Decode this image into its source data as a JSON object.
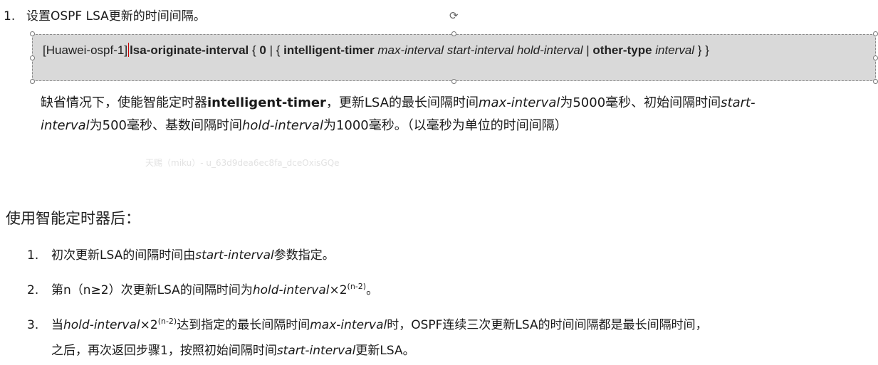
{
  "step1": {
    "number": "1.",
    "text": "设置OSPF LSA更新的时间间隔。"
  },
  "command": {
    "prompt": "[Huawei-ospf-1]",
    "cmd_a": "lsa",
    "cmd_b": "-originate-interval",
    "brace_open": " { ",
    "zero": "0",
    "sep1": " | { ",
    "intelligent": "intelligent-timer",
    "params": " max-interval start-interval hold-interval ",
    "sep2": "| ",
    "other": "other-type",
    "interval": " interval",
    "brace_close": " } }"
  },
  "default_para": {
    "t1": "缺省情况下，使能智能定时器",
    "kw": "intelligent-timer",
    "t2": "，更新LSA的最长间隔时间",
    "max": "max-interval",
    "t3": "为5000毫秒、初始间隔时间",
    "start_a": "start-",
    "start_b": "interval",
    "t4": "为500毫秒、基数间隔时间",
    "hold": "hold-interval",
    "t5": "为1000毫秒。（以毫秒为单位的时间间隔）"
  },
  "watermark": "天赐（miku）- u_63d9dea6ec8fa_dceOxisGQe",
  "heading": "使用智能定时器后：",
  "items": [
    {
      "number": "1.",
      "t1": "初次更新LSA的间隔时间由",
      "it": "start-interval",
      "t2": "参数指定。"
    },
    {
      "number": "2.",
      "t1": "第n（n≥2）次更新LSA的间隔时间为",
      "it": "hold-interval",
      "mul": "×2",
      "sup": "(n-2)",
      "t2": "。"
    },
    {
      "number": "3.",
      "t1": "当",
      "it": "hold-interval",
      "mul": "×2",
      "sup": "(n-2)",
      "t2": "达到指定的最长间隔时间",
      "it2": "max-interval",
      "t3": "时，OSPF连续三次更新LSA的时间间隔都是最长间隔时间，",
      "line2_t1": "之后，再次返回步骤1，按照初始间隔时间",
      "line2_it": "start-interval",
      "line2_t2": "更新LSA。"
    }
  ]
}
